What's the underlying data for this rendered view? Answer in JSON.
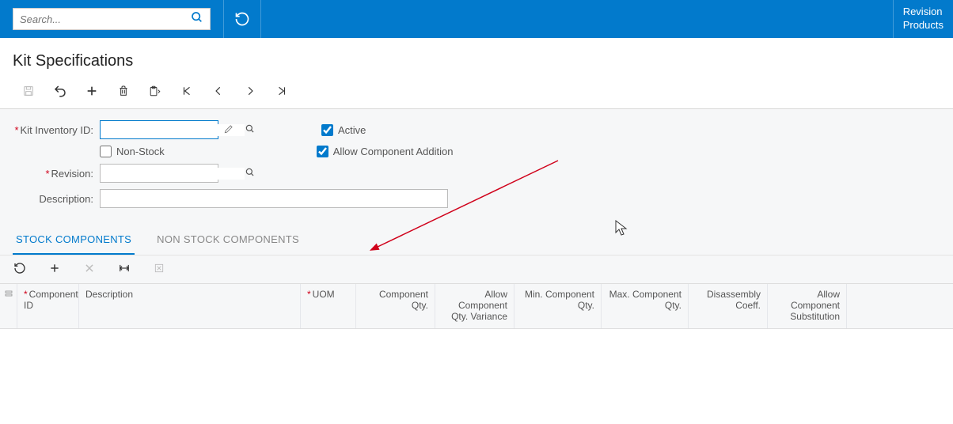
{
  "topbar": {
    "search_placeholder": "Search...",
    "right_line1": "Revision",
    "right_line2": "Products"
  },
  "page": {
    "title": "Kit Specifications"
  },
  "form": {
    "kit_inventory_label": "Kit Inventory ID:",
    "kit_inventory_value": "",
    "non_stock_label": "Non-Stock",
    "active_label": "Active",
    "allow_comp_add_label": "Allow Component Addition",
    "revision_label": "Revision:",
    "revision_value": "",
    "description_label": "Description:",
    "description_value": ""
  },
  "tabs": {
    "stock": "STOCK COMPONENTS",
    "nonstock": "NON STOCK COMPONENTS"
  },
  "grid": {
    "cols": {
      "component_id": "Component ID",
      "description": "Description",
      "uom": "UOM",
      "component_qty": "Component Qty.",
      "allow_qty_var": "Allow Component Qty. Variance",
      "min_qty": "Min. Component Qty.",
      "max_qty": "Max. Component Qty.",
      "disasm_coeff": "Disassembly Coeff.",
      "allow_sub": "Allow Component Substitution"
    }
  }
}
